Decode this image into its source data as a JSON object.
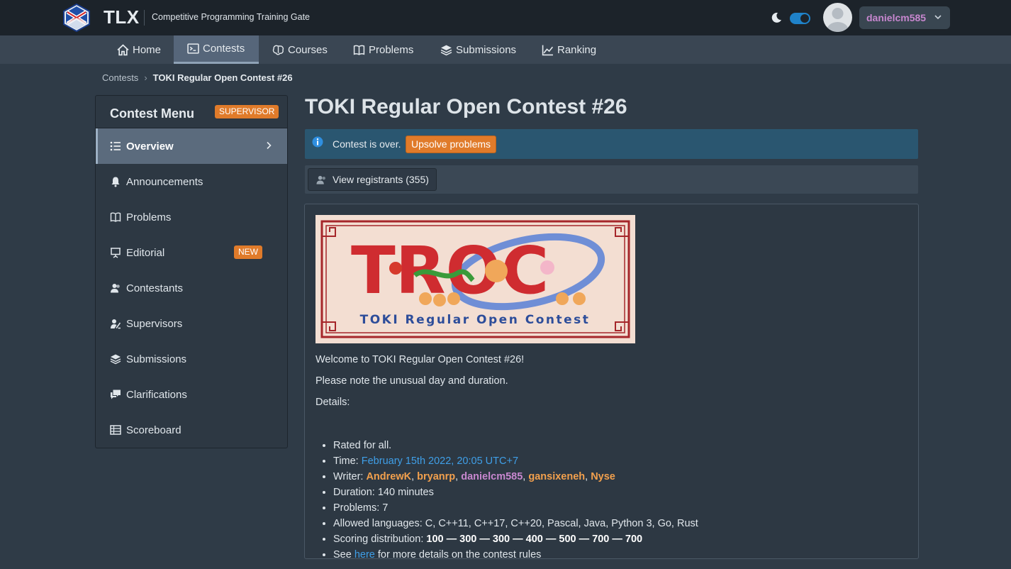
{
  "header": {
    "brand": "TLX",
    "tagline": "Competitive Programming Training Gate",
    "username": "danielcm585"
  },
  "nav": [
    {
      "label": "Home",
      "icon": "home-icon"
    },
    {
      "label": "Contests",
      "icon": "terminal-icon",
      "active": true
    },
    {
      "label": "Courses",
      "icon": "brain-icon"
    },
    {
      "label": "Problems",
      "icon": "book-icon"
    },
    {
      "label": "Submissions",
      "icon": "layers-icon"
    },
    {
      "label": "Ranking",
      "icon": "chart-icon"
    }
  ],
  "breadcrumb": [
    "Contests",
    "TOKI Regular Open Contest #26"
  ],
  "sidebar": {
    "title": "Contest Menu",
    "role_tag": "SUPERVISOR",
    "items": [
      {
        "label": "Overview",
        "icon": "list-icon",
        "active": true
      },
      {
        "label": "Announcements",
        "icon": "bell-icon"
      },
      {
        "label": "Problems",
        "icon": "book-icon"
      },
      {
        "label": "Editorial",
        "icon": "presentation-icon",
        "badge": "NEW"
      },
      {
        "label": "Contestants",
        "icon": "people-icon"
      },
      {
        "label": "Supervisors",
        "icon": "supervisor-icon"
      },
      {
        "label": "Submissions",
        "icon": "layers-icon"
      },
      {
        "label": "Clarifications",
        "icon": "chat-icon"
      },
      {
        "label": "Scoreboard",
        "icon": "table-icon"
      }
    ]
  },
  "main": {
    "title": "TOKI Regular Open Contest #26",
    "callout_text": "Contest is over.",
    "upsolve_label": "Upsolve problems",
    "registrants_label": "View registrants (355)",
    "banner": {
      "logo_text": "TROC",
      "subtitle": "TOKI Regular Open Contest"
    },
    "welcome": "Welcome to TOKI Regular Open Contest #26!",
    "note": "Please note the unusual day and duration.",
    "details_heading": "Details:",
    "details": {
      "rated": "Rated for all.",
      "time_label": "Time: ",
      "time_value": "February 15th 2022, 20:05 UTC+7",
      "writer_label": "Writer: ",
      "writers": [
        "AndrewK",
        "bryanrp",
        "danielcm585",
        "gansixeneh",
        "Nyse"
      ],
      "duration": "Duration: 140 minutes",
      "problems": "Problems: 7",
      "languages": "Allowed languages: C, C++11, C++17, C++20, Pascal, Java, Python 3, Go, Rust",
      "scoring_label": "Scoring distribution: ",
      "scoring_value": "100 — 300 — 300 — 400 — 500 — 700 — 700",
      "see_prefix": "See ",
      "see_link": "here",
      "see_suffix": " for more details on the contest rules"
    }
  },
  "colors": {
    "accent_orange": "#e07b2a",
    "link_blue": "#3f9fe8",
    "user_purple": "#c787cf",
    "user_orange": "#f2a04d"
  }
}
